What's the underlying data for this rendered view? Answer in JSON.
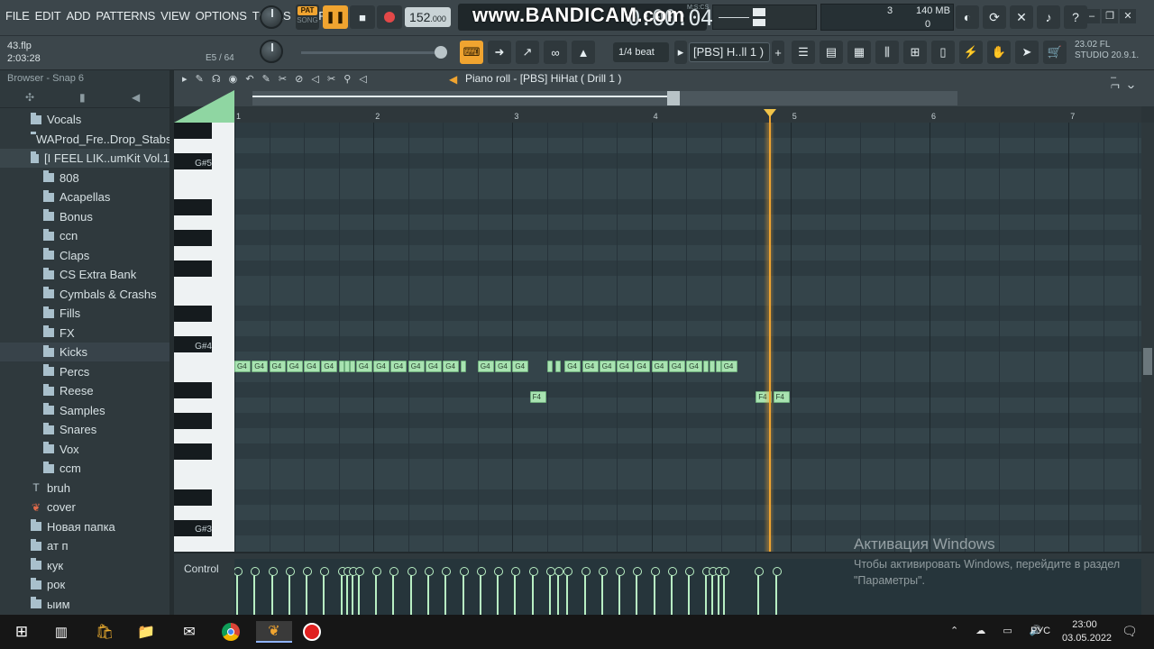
{
  "menu": [
    "FILE",
    "EDIT",
    "ADD",
    "PATTERNS",
    "VIEW",
    "OPTIONS",
    "TOOLS",
    "HELP"
  ],
  "transport": {
    "pat_label": "PAT",
    "song_label": "SONG",
    "tempo": "152",
    "tempo_dec": ".000",
    "time": "0:00:04",
    "time_units": "M:S:CS",
    "watermark": "www.BANDICAM.com"
  },
  "stats": {
    "cpu": "3",
    "memory": "140 MB",
    "polyphony": "0"
  },
  "project": {
    "file": "43.flp",
    "time": "2:03:28",
    "step_info": "E5 / 64"
  },
  "snap_label": "1/4 beat",
  "pattern_label": "[PBS] H..ll 1 )",
  "version": [
    "23.02  FL",
    "STUDIO 20.9.1."
  ],
  "browser": {
    "title": "Browser - Snap 6",
    "items": [
      {
        "label": "Vocals",
        "type": "folder",
        "indent": 1
      },
      {
        "label": "WAProd_Fre..Drop_Stabs",
        "type": "folder",
        "indent": 1
      },
      {
        "label": "[I FEEL LIK..umKit Vol.1",
        "type": "folder",
        "indent": 1,
        "selected": true
      },
      {
        "label": "808",
        "type": "folder",
        "indent": 2
      },
      {
        "label": "Acapellas",
        "type": "folder",
        "indent": 2
      },
      {
        "label": "Bonus",
        "type": "folder",
        "indent": 2
      },
      {
        "label": "ccn",
        "type": "folder",
        "indent": 2
      },
      {
        "label": "Claps",
        "type": "folder",
        "indent": 2
      },
      {
        "label": "CS Extra Bank",
        "type": "folder",
        "indent": 2
      },
      {
        "label": "Cymbals & Crashs",
        "type": "folder",
        "indent": 2
      },
      {
        "label": "Fills",
        "type": "folder",
        "indent": 2
      },
      {
        "label": "FX",
        "type": "folder",
        "indent": 2
      },
      {
        "label": "Kicks",
        "type": "folder",
        "indent": 2,
        "highlight": true
      },
      {
        "label": "Percs",
        "type": "folder",
        "indent": 2
      },
      {
        "label": "Reese",
        "type": "folder",
        "indent": 2
      },
      {
        "label": "Samples",
        "type": "folder",
        "indent": 2
      },
      {
        "label": "Snares",
        "type": "folder",
        "indent": 2
      },
      {
        "label": "Vox",
        "type": "folder",
        "indent": 2
      },
      {
        "label": "ccm",
        "type": "folder",
        "indent": 2
      },
      {
        "label": "bruh",
        "type": "text",
        "indent": 1
      },
      {
        "label": "cover",
        "type": "image",
        "indent": 1
      },
      {
        "label": "Новая папка",
        "type": "folder",
        "indent": 1
      },
      {
        "label": "ат п",
        "type": "folder",
        "indent": 1
      },
      {
        "label": "кук",
        "type": "folder",
        "indent": 1
      },
      {
        "label": "рок",
        "type": "folder",
        "indent": 1
      },
      {
        "label": "ыим",
        "type": "folder",
        "indent": 1
      }
    ]
  },
  "piano_roll": {
    "title": "Piano roll - [PBS] HiHat ( Drill 1 )",
    "bars": [
      "1",
      "2",
      "3",
      "4",
      "5",
      "6",
      "7"
    ],
    "key_labels": [
      "G#5",
      "G#4",
      "G#3"
    ],
    "control_label": "Control",
    "notes": [
      {
        "label": "G4",
        "pitch": "G4",
        "start": 0.0
      },
      {
        "label": "G4",
        "pitch": "G4",
        "start": 0.125
      },
      {
        "label": "G4",
        "pitch": "G4",
        "start": 0.25
      },
      {
        "label": "G4",
        "pitch": "G4",
        "start": 0.375
      },
      {
        "label": "G4",
        "pitch": "G4",
        "start": 0.5
      },
      {
        "label": "G4",
        "pitch": "G4",
        "start": 0.625
      },
      {
        "label": "",
        "pitch": "G4",
        "start": 0.75,
        "short": true
      },
      {
        "label": "",
        "pitch": "G4",
        "start": 0.79,
        "short": true
      },
      {
        "label": "",
        "pitch": "G4",
        "start": 0.83,
        "short": true
      },
      {
        "label": "G4",
        "pitch": "G4",
        "start": 0.875
      },
      {
        "label": "G4",
        "pitch": "G4",
        "start": 1.0
      },
      {
        "label": "G4",
        "pitch": "G4",
        "start": 1.125
      },
      {
        "label": "G4",
        "pitch": "G4",
        "start": 1.25
      },
      {
        "label": "G4",
        "pitch": "G4",
        "start": 1.375
      },
      {
        "label": "G4",
        "pitch": "G4",
        "start": 1.5
      },
      {
        "label": "",
        "pitch": "G4",
        "start": 1.625,
        "short": true
      },
      {
        "label": "G4",
        "pitch": "G4",
        "start": 1.75
      },
      {
        "label": "G4",
        "pitch": "G4",
        "start": 1.875
      },
      {
        "label": "G4",
        "pitch": "G4",
        "start": 2.0
      },
      {
        "label": "F4",
        "pitch": "F4",
        "start": 2.125
      },
      {
        "label": "",
        "pitch": "G4",
        "start": 2.25,
        "short": true
      },
      {
        "label": "",
        "pitch": "G4",
        "start": 2.31,
        "short": true
      },
      {
        "label": "G4",
        "pitch": "G4",
        "start": 2.375
      },
      {
        "label": "G4",
        "pitch": "G4",
        "start": 2.5
      },
      {
        "label": "G4",
        "pitch": "G4",
        "start": 2.625
      },
      {
        "label": "G4",
        "pitch": "G4",
        "start": 2.75
      },
      {
        "label": "G4",
        "pitch": "G4",
        "start": 2.875
      },
      {
        "label": "G4",
        "pitch": "G4",
        "start": 3.0
      },
      {
        "label": "G4",
        "pitch": "G4",
        "start": 3.125
      },
      {
        "label": "G4",
        "pitch": "G4",
        "start": 3.25
      },
      {
        "label": "",
        "pitch": "G4",
        "start": 3.375,
        "short": true
      },
      {
        "label": "",
        "pitch": "G4",
        "start": 3.42,
        "short": true
      },
      {
        "label": "",
        "pitch": "G4",
        "start": 3.46,
        "short": true
      },
      {
        "label": "G4",
        "pitch": "G4",
        "start": 3.5
      },
      {
        "label": "F4",
        "pitch": "F4",
        "start": 3.75
      },
      {
        "label": "F4",
        "pitch": "F4",
        "start": 3.875
      }
    ]
  },
  "windows_activation": {
    "title": "Активация Windows",
    "text": "Чтобы активировать Windows, перейдите в раздел \"Параметры\"."
  },
  "taskbar": {
    "language": "РУС",
    "time": "23:00",
    "date": "03.05.2022"
  },
  "colors": {
    "accent": "#f0a430",
    "note_fill": "#a8e3b1",
    "grid_bg": "#34444a"
  }
}
